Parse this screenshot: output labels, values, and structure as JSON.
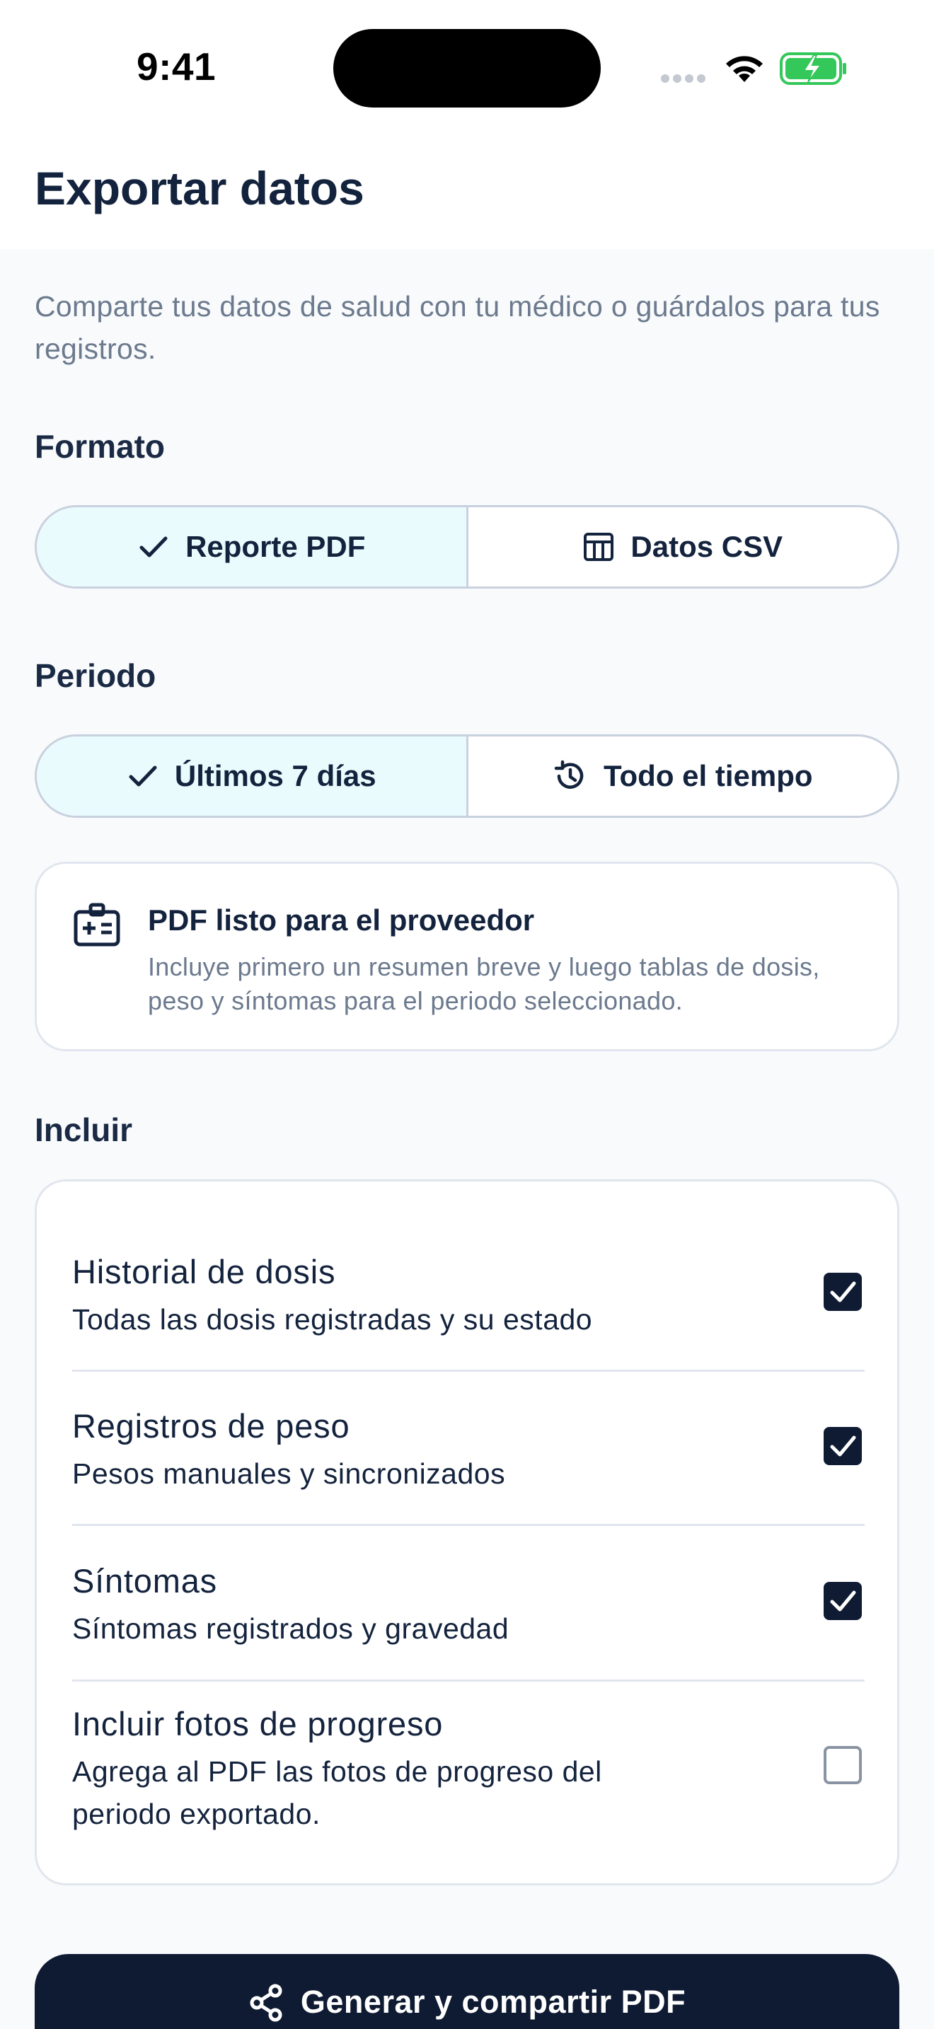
{
  "status_bar": {
    "time": "9:41"
  },
  "header": {
    "title": "Exportar datos"
  },
  "intro": "Comparte tus datos de salud con tu médico o guárdalos para tus registros.",
  "format": {
    "label": "Formato",
    "options": [
      {
        "label": "Reporte PDF",
        "icon": "check-icon",
        "selected": true
      },
      {
        "label": "Datos CSV",
        "icon": "table-icon",
        "selected": false
      }
    ]
  },
  "period": {
    "label": "Periodo",
    "options": [
      {
        "label": "Últimos 7 días",
        "icon": "check-icon",
        "selected": true
      },
      {
        "label": "Todo el tiempo",
        "icon": "history-icon",
        "selected": false
      }
    ]
  },
  "info": {
    "icon": "medical-id-icon",
    "title": "PDF listo para el proveedor",
    "description": "Incluye primero un resumen breve y luego tablas de dosis, peso y síntomas para el periodo seleccionado."
  },
  "include": {
    "label": "Incluir",
    "items": [
      {
        "title": "Historial de dosis",
        "subtitle": "Todas las dosis registradas y su estado",
        "checked": true
      },
      {
        "title": "Registros de peso",
        "subtitle": "Pesos manuales y sincronizados",
        "checked": true
      },
      {
        "title": "Síntomas",
        "subtitle": "Síntomas registrados y gravedad",
        "checked": true
      },
      {
        "title": "Incluir fotos de progreso",
        "subtitle": "Agrega al PDF las fotos de progreso del periodo exportado.",
        "checked": false
      }
    ]
  },
  "action": {
    "label": "Generar y compartir PDF",
    "icon": "share-icon"
  },
  "colors": {
    "primary": "#0f1b33",
    "selected_bg": "#e9fbfd",
    "muted_text": "#6c7a8e",
    "battery_green": "#34c759"
  }
}
